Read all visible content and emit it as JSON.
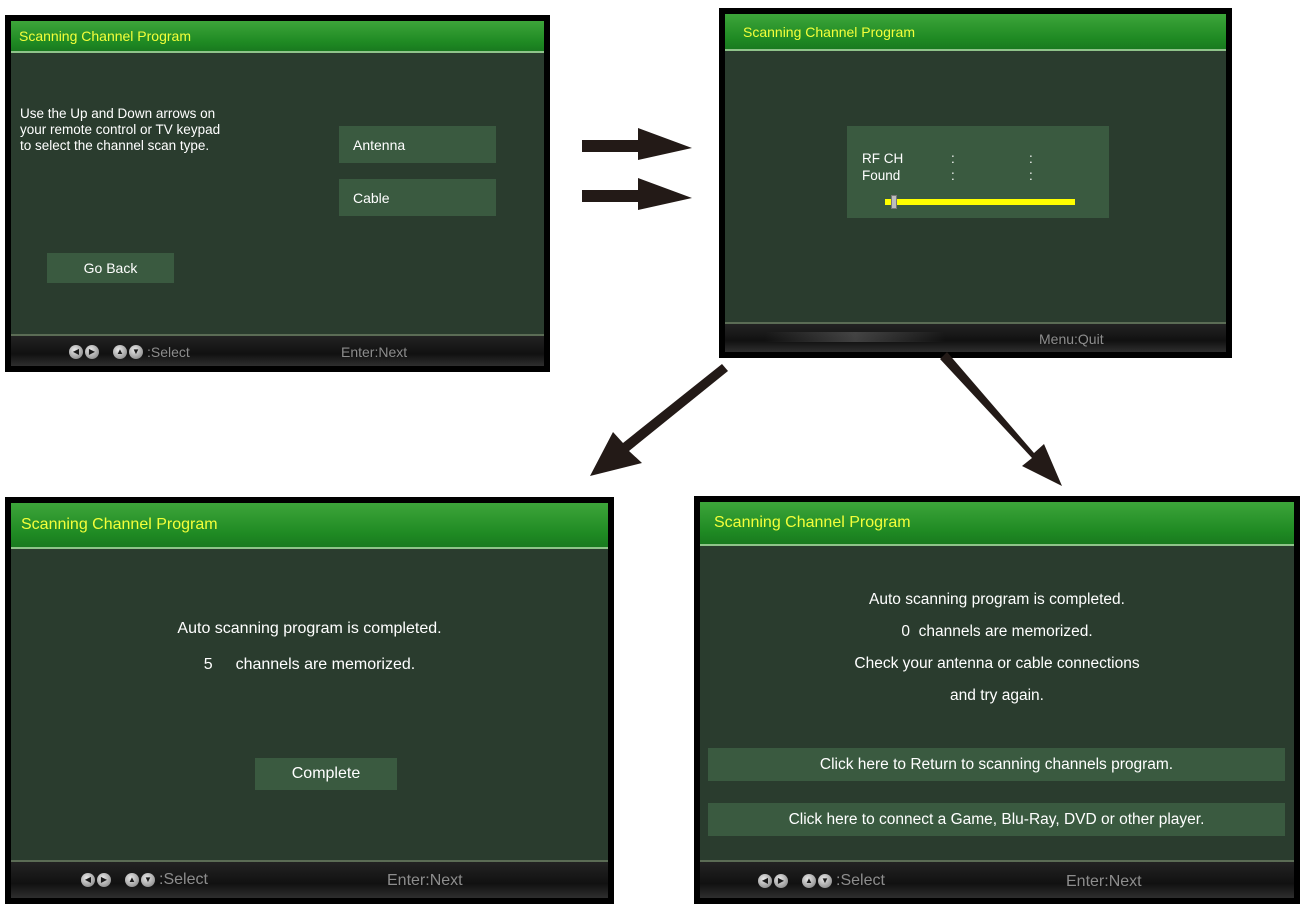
{
  "common": {
    "title": "Scanning Channel Program",
    "select_label": ":Select",
    "next_label": "Enter:Next"
  },
  "screen1": {
    "instructions": [
      "Use the Up and Down arrows on",
      "your remote control or TV keypad",
      "to select the channel scan type."
    ],
    "antenna_label": "Antenna",
    "cable_label": "Cable",
    "go_back_label": "Go Back"
  },
  "screen2": {
    "rf_ch_label": "RF CH",
    "found_label": "Found",
    "colon": ":",
    "progress_fraction": 0.03,
    "quit_label": "Menu:Quit"
  },
  "screen3": {
    "line1": "Auto scanning program is completed.",
    "count": "5",
    "line2": "channels are memorized.",
    "complete_label": "Complete"
  },
  "screen4": {
    "lines": [
      "Auto scanning program is completed.",
      "0  channels are memorized.",
      "Check your antenna or cable connections",
      "and try again."
    ],
    "return_label": "Click here to Return to scanning channels program.",
    "connect_label": "Click here to connect a Game, Blu-Ray, DVD or other player."
  },
  "colors": {
    "title_text": "#f3ff3a",
    "progress": "#ffff00",
    "panel_bg": "#2a3c2e",
    "button_bg": "#3a5a40"
  },
  "icons": [
    "left-right-arrows-icon",
    "up-down-arrows-icon",
    "flow-arrow-icon"
  ]
}
